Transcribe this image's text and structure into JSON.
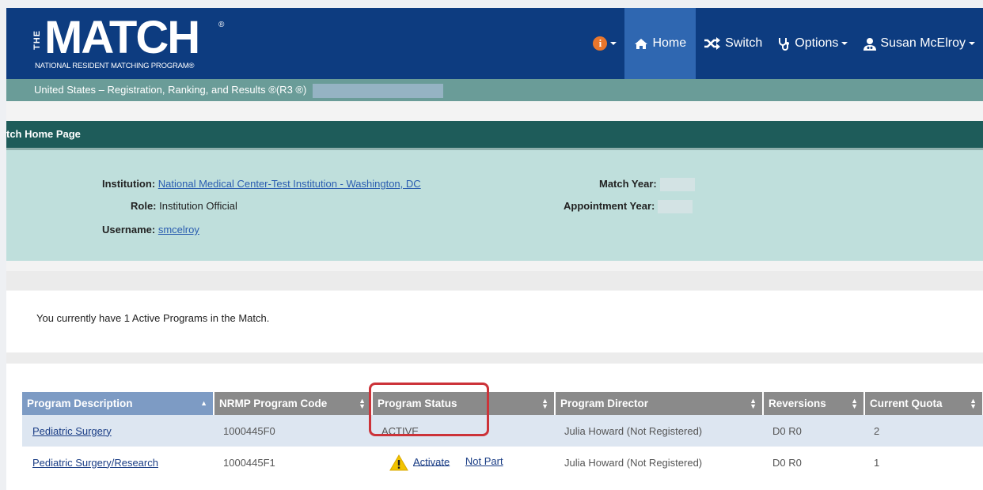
{
  "brand": {
    "logo_the": "THE",
    "logo_main": "MATCH",
    "logo_reg": "®",
    "logo_sub": "NATIONAL RESIDENT MATCHING PROGRAM®"
  },
  "nav": {
    "home": "Home",
    "switch": "Switch",
    "options": "Options",
    "user": "Susan McElroy"
  },
  "subbar": {
    "text": "United States  –  Registration, Ranking, and Results ®(R3 ®)"
  },
  "page_title": "tch Home Page",
  "info": {
    "institution_label": "Institution:",
    "institution_value": "National Medical Center-Test Institution - Washington, DC",
    "role_label": "Role:",
    "role_value": "Institution Official",
    "username_label": "Username:",
    "username_value": "smcelroy",
    "match_year_label": "Match Year:",
    "appointment_year_label": "Appointment Year:"
  },
  "notice": "You currently have 1 Active Programs in the Match.",
  "table": {
    "headers": [
      "Program Description",
      "NRMP Program Code",
      "Program Status",
      "Program Director",
      "Reversions",
      "Current Quota"
    ],
    "rows": [
      {
        "description": "Pediatric Surgery",
        "code": "1000445F0",
        "status": "ACTIVE",
        "director": "Julia Howard (Not Registered)",
        "reversions": "D0 R0",
        "quota": "2"
      },
      {
        "description": "Pediatric Surgery/Research",
        "code": "1000445F1",
        "activate": "Activate",
        "not_part": "Not Part",
        "director": "Julia Howard (Not Registered)",
        "reversions": "D0 R0",
        "quota": "1"
      }
    ]
  },
  "colors": {
    "header_bg": "#0d3c80",
    "nav_active": "#2f67b1",
    "subbar": "#6a9c98",
    "page_bar": "#1e5c5a",
    "info_panel": "#bfdfdc",
    "highlight": "#cc3339"
  }
}
